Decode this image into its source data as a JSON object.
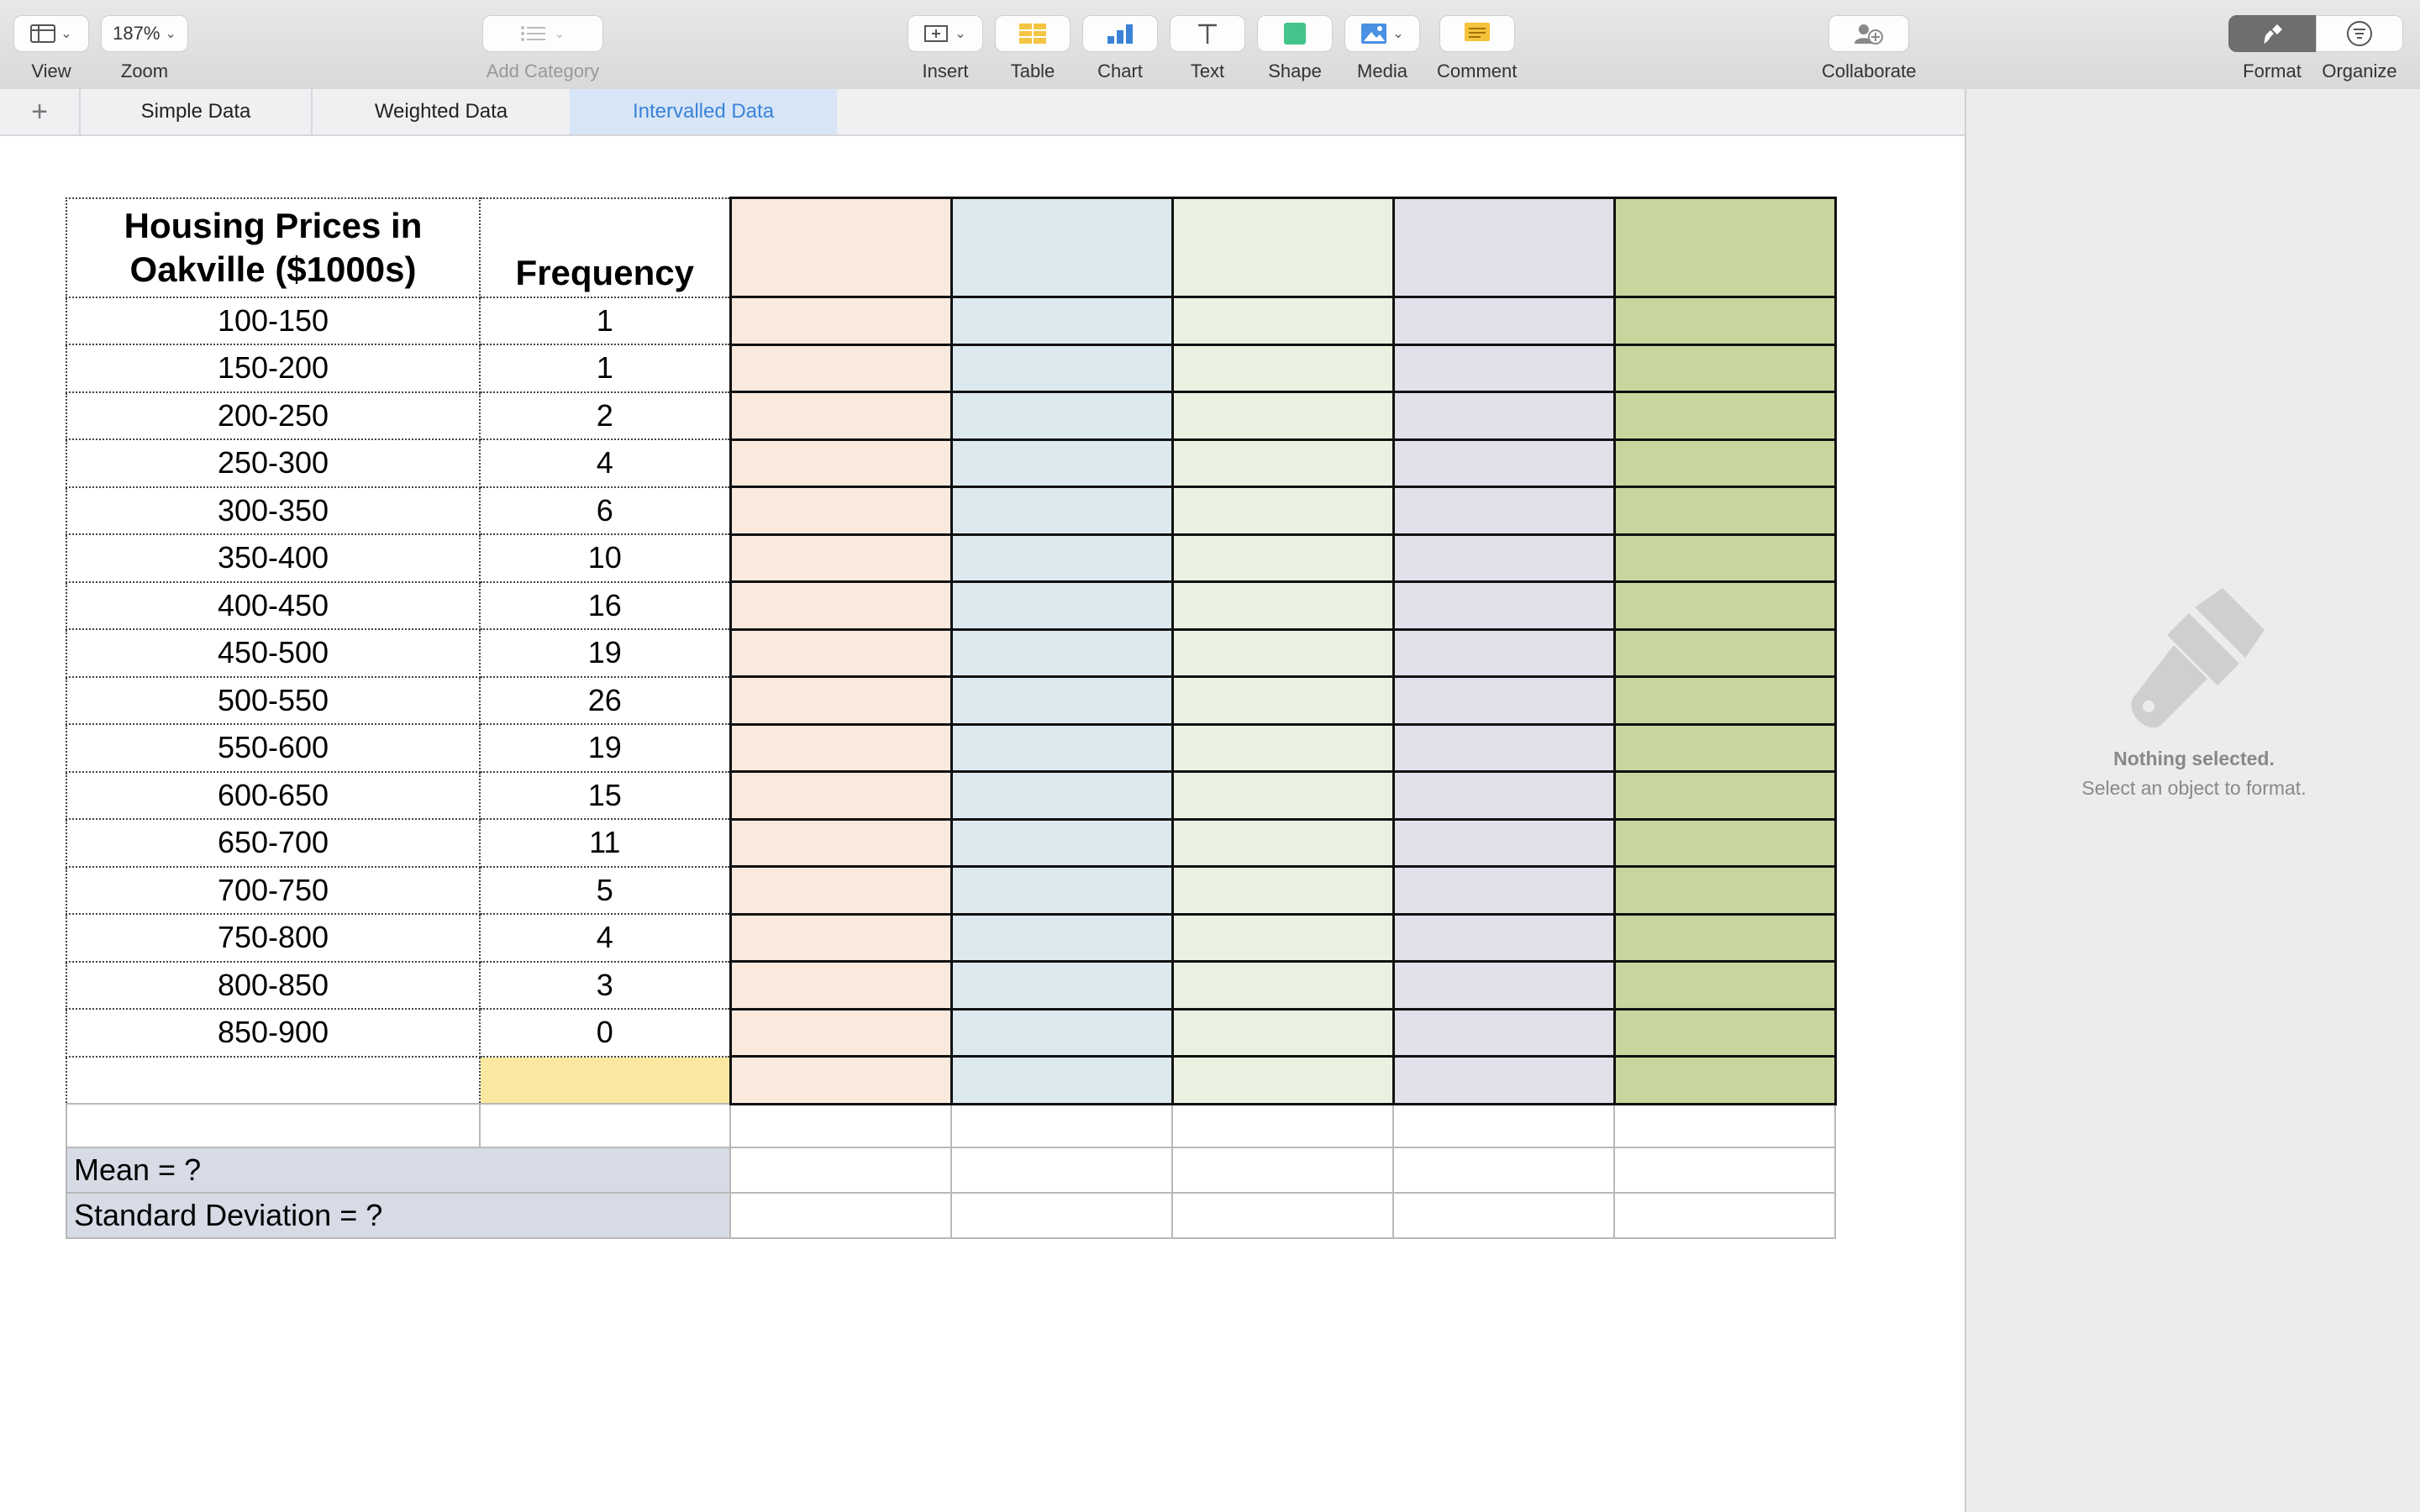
{
  "toolbar": {
    "view": "View",
    "zoom_value": "187%",
    "zoom": "Zoom",
    "add_category": "Add Category",
    "insert": "Insert",
    "table": "Table",
    "chart": "Chart",
    "text": "Text",
    "shape": "Shape",
    "media": "Media",
    "comment": "Comment",
    "collaborate": "Collaborate",
    "format": "Format",
    "organize": "Organize"
  },
  "tabs": [
    {
      "label": "Simple Data",
      "active": false
    },
    {
      "label": "Weighted Data",
      "active": false
    },
    {
      "label": "Intervalled Data",
      "active": true
    }
  ],
  "sidebar": {
    "title": "Nothing selected.",
    "subtitle": "Select an object to format."
  },
  "table": {
    "header": {
      "col1": "Housing Prices in Oakville ($1000s)",
      "col2": "Frequency"
    },
    "rows": [
      {
        "interval": "100-150",
        "frequency": "1"
      },
      {
        "interval": "150-200",
        "frequency": "1"
      },
      {
        "interval": "200-250",
        "frequency": "2"
      },
      {
        "interval": "250-300",
        "frequency": "4"
      },
      {
        "interval": "300-350",
        "frequency": "6"
      },
      {
        "interval": "350-400",
        "frequency": "10"
      },
      {
        "interval": "400-450",
        "frequency": "16"
      },
      {
        "interval": "450-500",
        "frequency": "19"
      },
      {
        "interval": "500-550",
        "frequency": "26"
      },
      {
        "interval": "550-600",
        "frequency": "19"
      },
      {
        "interval": "600-650",
        "frequency": "15"
      },
      {
        "interval": "650-700",
        "frequency": "11"
      },
      {
        "interval": "700-750",
        "frequency": "5"
      },
      {
        "interval": "750-800",
        "frequency": "4"
      },
      {
        "interval": "800-850",
        "frequency": "3"
      },
      {
        "interval": "850-900",
        "frequency": "0"
      }
    ],
    "mean": "Mean = ?",
    "std_dev": "Standard Deviation = ?"
  },
  "colors": {
    "col1": "#fae9dd",
    "col2": "#dceaf0",
    "col3": "#ebf1e0",
    "col4": "#e3dfeb",
    "col5": "#c8d69d",
    "total_cell": "#fbe8a0",
    "summary": "#d6dbe6",
    "active_tab": "#3a83d8"
  }
}
